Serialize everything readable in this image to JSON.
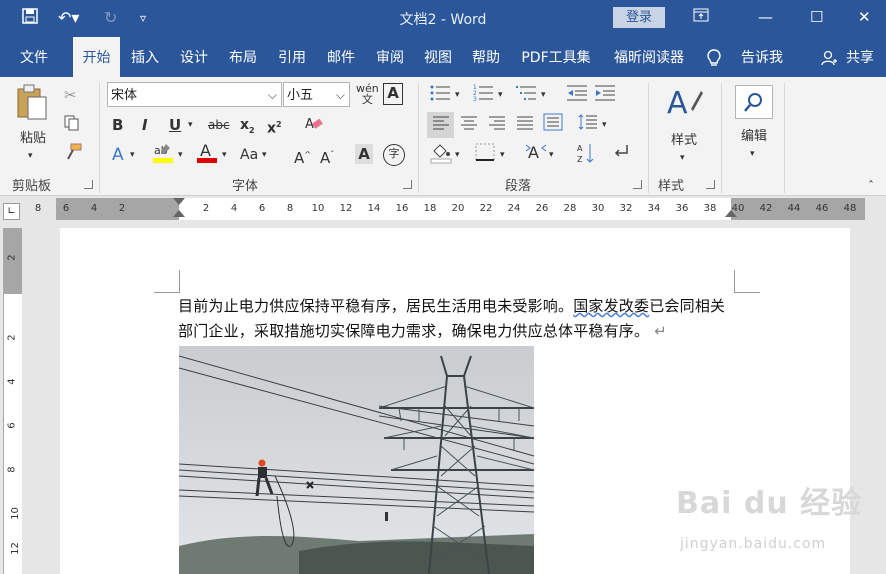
{
  "window": {
    "title": "文档2  -  Word",
    "login": "登录"
  },
  "tabs": [
    "文件",
    "开始",
    "插入",
    "设计",
    "布局",
    "引用",
    "邮件",
    "审阅",
    "视图",
    "帮助",
    "PDF工具集",
    "福昕阅读器",
    "告诉我",
    "共享"
  ],
  "ribbon": {
    "clipboard": {
      "paste": "粘贴",
      "label": "剪贴板"
    },
    "font": {
      "name": "宋体",
      "size": "小五",
      "label": "字体"
    },
    "paragraph": {
      "label": "段落"
    },
    "styles": {
      "button": "样式",
      "label": "样式"
    },
    "editing": {
      "button": "编辑"
    }
  },
  "ruler": {
    "top": [
      "8",
      "6",
      "4",
      "2",
      "2",
      "4",
      "6",
      "8",
      "10",
      "12",
      "14",
      "16",
      "18",
      "20",
      "22",
      "24",
      "26",
      "28",
      "30",
      "32",
      "34",
      "36",
      "38",
      "40",
      "42",
      "44",
      "46",
      "48"
    ],
    "left": [
      "2",
      "2",
      "4",
      "6",
      "8",
      "10",
      "12"
    ]
  },
  "document": {
    "text_a": "目前为止电力供应保持平稳有序，居民生活用电未受影响。",
    "text_wavy": "国家发改委",
    "text_b": "已会同相关部门企业，采取措施切实保障电力需求，确保电力供应总体平稳有序。",
    "para_mark": "↵"
  },
  "watermark": {
    "brand": "Bai du 经验",
    "url": "jingyan.baidu.com"
  },
  "colors": {
    "accent": "#2b579a",
    "highlight": "#ffff00",
    "font_color": "#e00000"
  }
}
